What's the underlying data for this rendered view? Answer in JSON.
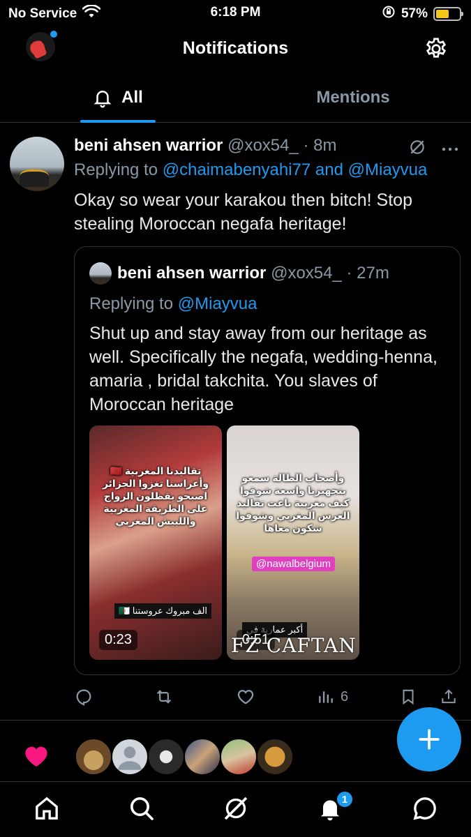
{
  "status_bar": {
    "carrier": "No Service",
    "time": "6:18 PM",
    "battery": "57%",
    "battery_level": 0.57
  },
  "header": {
    "title": "Notifications"
  },
  "tabs": [
    {
      "label": "All"
    },
    {
      "label": "Mentions"
    }
  ],
  "tweet": {
    "author_name": "beni ahsen warrior",
    "author_handle": "@xox54_",
    "time": "· 8m",
    "replying_prefix": "Replying to",
    "replying_to_1": "@chaimabenyahi77",
    "replying_and": "and",
    "replying_to_2": "@Miayvua",
    "text": "Okay so wear your karakou then bitch! Stop stealing Moroccan negafa heritage!",
    "quote": {
      "author_name": "beni ahsen warrior",
      "author_handle": "@xox54_",
      "time": "· 27m",
      "replying_prefix": "Replying to",
      "replying_to": "@Miayvua",
      "text": "Shut up and stay away from our heritage as well. Specifically the negafa, wedding-henna, amaria , bridal takchita. You slaves of Moroccan heritage",
      "media": [
        {
          "duration": "0:23",
          "caption": "تقاليدنا المغربية 🇲🇦 وأعراسنا تغزوا الجزائر اصبحو يقظلون الزواج على الطريقة المغربية واللبيش المغربي",
          "stamp": "الف مبروك عروستنا 🇩🇿"
        },
        {
          "duration": "0:51",
          "caption": "وأصحاب الطالة سمعو بتجهيزنا واسعة شوفوا كيف مغربية باعت تقاليد العرس المغربي وشوفوا شكون معاها",
          "tag": "@nawalbelgium",
          "stamp": "أكبر عمارية في",
          "brand": "FZ CAFTAN"
        }
      ]
    },
    "views": "6"
  },
  "fab": {
    "label": "+"
  },
  "nav": {
    "notification_badge": "1"
  },
  "colors": {
    "accent": "#1d9bf0",
    "background": "#000000",
    "like": "#f91880",
    "muted": "#8b98a5"
  }
}
